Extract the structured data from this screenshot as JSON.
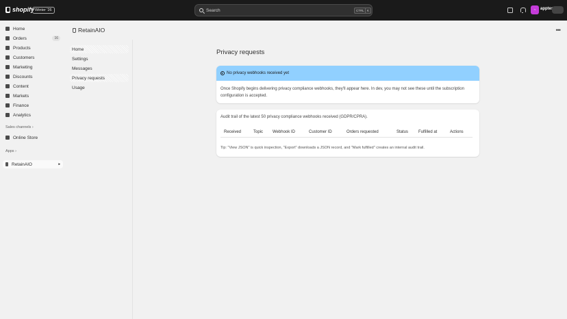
{
  "topbar": {
    "brand": "shopify",
    "edition": "Winter '26",
    "search_placeholder": "Search",
    "kbd_ctrl": "CTRL",
    "kbd_k": "K",
    "avatar_initials": "~",
    "user_name": "apptest"
  },
  "sidebar": {
    "items": [
      {
        "label": "Home",
        "icon": "home-icon"
      },
      {
        "label": "Orders",
        "icon": "orders-icon",
        "badge": "16"
      },
      {
        "label": "Products",
        "icon": "tag-icon"
      },
      {
        "label": "Customers",
        "icon": "person-icon"
      },
      {
        "label": "Marketing",
        "icon": "target-icon"
      },
      {
        "label": "Discounts",
        "icon": "discount-icon"
      },
      {
        "label": "Content",
        "icon": "content-icon"
      },
      {
        "label": "Markets",
        "icon": "globe-icon"
      },
      {
        "label": "Finance",
        "icon": "bank-icon"
      },
      {
        "label": "Analytics",
        "icon": "chart-icon"
      }
    ],
    "sales_channels_label": "Sales channels",
    "online_store_label": "Online Store",
    "apps_label": "Apps",
    "app_item_label": "RetainAIO"
  },
  "app": {
    "title": "RetainAIO",
    "menu": [
      "Home",
      "Settings",
      "Messages",
      "Privacy requests",
      "Usage"
    ]
  },
  "page": {
    "title": "Privacy requests",
    "banner": "No privacy webhooks received yet",
    "banner_body": "Once Shopify begins delivering privacy compliance webhooks, they'll appear here. In dev, you may not see these until the subscription configuration is accepted.",
    "audit_intro": "Audit trail of the latest 50 privacy compliance webhooks received (GDPR/CPRA).",
    "columns": [
      "Received",
      "Topic",
      "Webhook ID",
      "Customer ID",
      "Orders requested",
      "Status",
      "Fulfilled at",
      "Actions"
    ],
    "tip": "Tip: \"View JSON\" is quick inspection, \"Export\" downloads a JSON record, and \"Mark fulfilled\" creates an internal audit trail."
  },
  "colors": {
    "topbar": "#1a1a1a",
    "banner": "#91d0ff",
    "avatar": "#c43bd9"
  }
}
